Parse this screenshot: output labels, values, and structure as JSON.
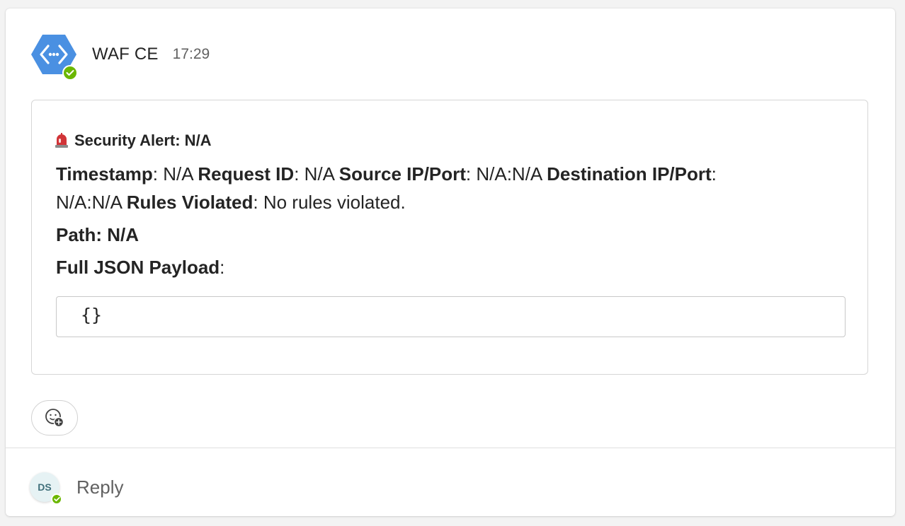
{
  "message": {
    "sender": "WAF CE",
    "time": "17:29",
    "bot_status": "available"
  },
  "alert": {
    "title": "Security Alert: N/A",
    "title_icon": "police-siren-icon",
    "timestamp_label": "Timestamp",
    "timestamp_value": ": N/A ",
    "request_id_label": "Request ID",
    "request_id_value": ": N/A ",
    "source_label": "Source IP/Port",
    "source_value": ": N/A:N/A ",
    "destination_label": "Destination IP/Port",
    "destination_sep": ":",
    "destination_value": "N/A:N/A ",
    "rules_label": "Rules Violated",
    "rules_value": ": No rules violated.",
    "path_label": "Path: N/A",
    "payload_label": "Full JSON Payload",
    "payload_sep": ":",
    "payload_code": "{}"
  },
  "reactions": {
    "add_reaction_icon": "emoji-add-icon"
  },
  "reply": {
    "avatar_initials": "DS",
    "label": "Reply"
  },
  "colors": {
    "bot_blue": "#4a90e2",
    "presence_green": "#6bb700",
    "siren_red": "#d13438"
  }
}
